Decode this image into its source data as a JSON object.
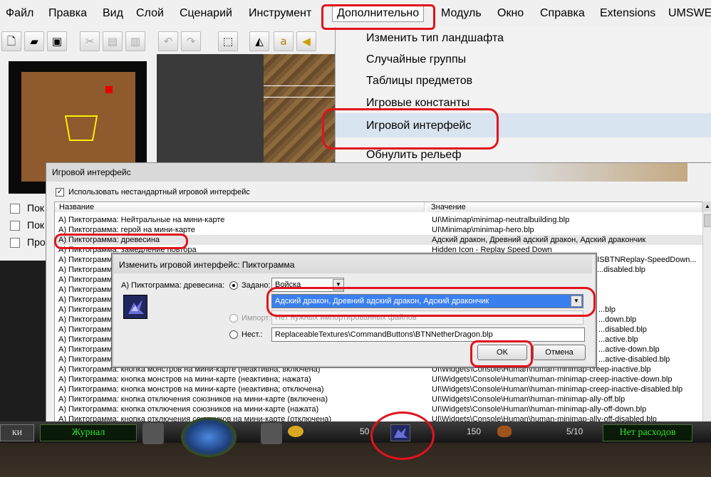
{
  "menubar": {
    "items": [
      "Файл",
      "Правка",
      "Вид",
      "Слой",
      "Сценарий",
      "Инструмент",
      "Дополнительно",
      "Модуль",
      "Окно",
      "Справка",
      "Extensions",
      "UMSWE"
    ]
  },
  "toolbar": {
    "icons": [
      "new-file-icon",
      "open-folder-icon",
      "save-icon",
      "cut-icon",
      "copy-icon",
      "paste-icon",
      "undo-icon",
      "redo-icon",
      "select-icon",
      "terrain-icon",
      "doodad-icon",
      "sound-icon"
    ]
  },
  "left_panel": {
    "checkboxes": [
      "Пок",
      "Пок",
      "Про"
    ]
  },
  "dropdown_menu": {
    "items": [
      {
        "label": "Изменить тип ландшафта"
      },
      {
        "label": "Случайные группы"
      },
      {
        "label": "Таблицы предметов"
      },
      {
        "label": "Игровые константы"
      },
      {
        "label": "Игровой интерфейс"
      },
      {
        "label": "Обнулить рельеф"
      }
    ]
  },
  "dialog": {
    "title": "Игровой интерфейс",
    "use_custom_label": "Использовать нестандартный игровой интерфейс",
    "col_name": "Название",
    "col_value": "Значение",
    "rows": [
      {
        "name": "А) Пиктограмма: Нейтральные на мини-карте",
        "value": "UI\\Minimap\\minimap-neutralbuilding.blp"
      },
      {
        "name": "А) Пиктограмма: герой на мини-карте",
        "value": "UI\\Minimap\\minimap-hero.blp"
      },
      {
        "name": "А) Пиктограмма: древесина",
        "value": "Адский дракон, Древний адский дракон, Адский дракончик"
      },
      {
        "name": "А) Пиктограмма: замедление повтора",
        "value": "Hidden Icon - Replay Speed Down"
      },
      {
        "name": "А) Пиктограмма",
        "value": "...\\DISBTNReplay-SpeedDown..."
      },
      {
        "name": "А) Пиктограмма",
        "value": "...disabled.blp"
      },
      {
        "name": "А) Пиктограмма",
        "value": ""
      },
      {
        "name": "А) Пиктограмма",
        "value": ""
      },
      {
        "name": "А) Пиктограмма",
        "value": ""
      },
      {
        "name": "А) Пиктограмма",
        "value": "...blp"
      },
      {
        "name": "А) Пиктограмма",
        "value": "...down.blp"
      },
      {
        "name": "А) Пиктограмма",
        "value": "...disabled.blp"
      },
      {
        "name": "А) Пиктограмма",
        "value": "...active.blp"
      },
      {
        "name": "А) Пиктограмма",
        "value": "...active-down.blp"
      },
      {
        "name": "А) Пиктограмма",
        "value": "...active-disabled.blp"
      },
      {
        "name": "А) Пиктограмма: кнопка монстров на мини-карте (неактивна; включена)",
        "value": "UI\\Widgets\\Console\\Human\\human-minimap-creep-inactive.blp"
      },
      {
        "name": "А) Пиктограмма: кнопка монстров на мини-карте (неактивна; нажата)",
        "value": "UI\\Widgets\\Console\\Human\\human-minimap-creep-inactive-down.blp"
      },
      {
        "name": "А) Пиктограмма: кнопка монстров на мини-карте (неактивна; отключена)",
        "value": "UI\\Widgets\\Console\\Human\\human-minimap-creep-inactive-disabled.blp"
      },
      {
        "name": "А) Пиктограмма: кнопка отключения союзников на мини-карте (включена)",
        "value": "UI\\Widgets\\Console\\Human\\human-minimap-ally-off.blp"
      },
      {
        "name": "А) Пиктограмма: кнопка отключения союзников на мини-карте (нажата)",
        "value": "UI\\Widgets\\Console\\Human\\human-minimap-ally-off-down.blp"
      },
      {
        "name": "А) Пиктограмма: кнопка отключения союзников на мини-карте (отключена)",
        "value": "UI\\Widgets\\Console\\Human\\human-minimap-ally-off-disabled.blp"
      }
    ]
  },
  "subdialog": {
    "title": "Изменить игровой интерфейс: Пиктограмма",
    "field_label": "А) Пиктограмма: древесина:",
    "radio_set": "Задано:",
    "radio_import": "Импорт:",
    "radio_custom": "Нест.:",
    "category_value": "Войска",
    "unit_value": "Адский дракон, Древний адский дракон, Адский дракончик",
    "import_value": "Нет нужных импортированных файлов",
    "custom_value": "ReplaceableTextures\\CommandButtons\\BTNNetherDragon.blp",
    "ok_label": "OK",
    "cancel_label": "Отмена"
  },
  "gamebar": {
    "left_label": "ки",
    "journal": "Журнал",
    "gold": "50",
    "lumber": "150",
    "food": "5/10",
    "upkeep": "Нет расходов"
  },
  "colors": {
    "annotation": "#e2131d",
    "gamebar_text": "#2fe32f",
    "selection": "#3a7ff0"
  }
}
